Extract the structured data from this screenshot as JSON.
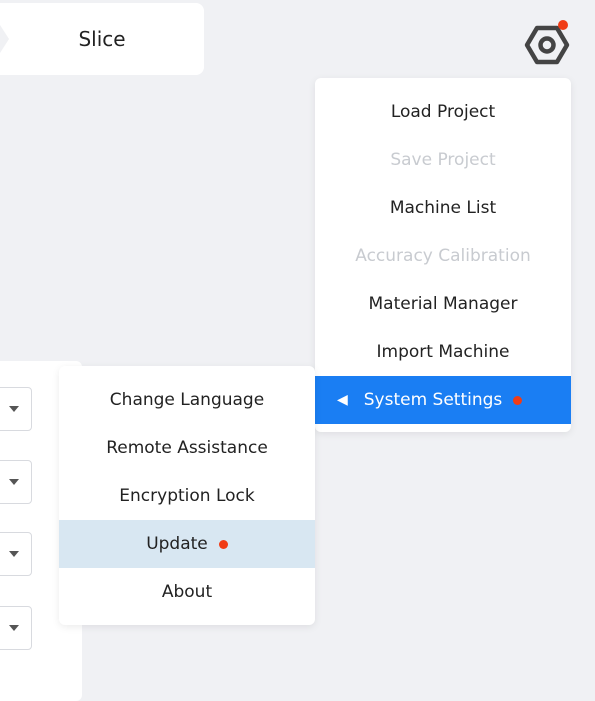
{
  "tab": {
    "label": "Slice"
  },
  "main_menu": {
    "items": [
      {
        "label": "Load Project",
        "disabled": false
      },
      {
        "label": "Save Project",
        "disabled": true
      },
      {
        "label": "Machine List",
        "disabled": false
      },
      {
        "label": "Accuracy Calibration",
        "disabled": true
      },
      {
        "label": "Material Manager",
        "disabled": false
      },
      {
        "label": "Import Machine",
        "disabled": false
      },
      {
        "label": "System Settings",
        "disabled": false,
        "active": true,
        "badge": true
      }
    ]
  },
  "sub_menu": {
    "items": [
      {
        "label": "Change Language"
      },
      {
        "label": "Remote Assistance"
      },
      {
        "label": "Encryption Lock"
      },
      {
        "label": "Update",
        "highlighted": true,
        "badge": true
      },
      {
        "label": "About"
      }
    ]
  },
  "icons": {
    "settings": "hex-gear-icon",
    "submenu_arrow": "◀"
  },
  "colors": {
    "accent": "#1a7ef3",
    "badge": "#f03c16",
    "hover": "#d8e7f2",
    "disabled": "#c8cbd0"
  }
}
